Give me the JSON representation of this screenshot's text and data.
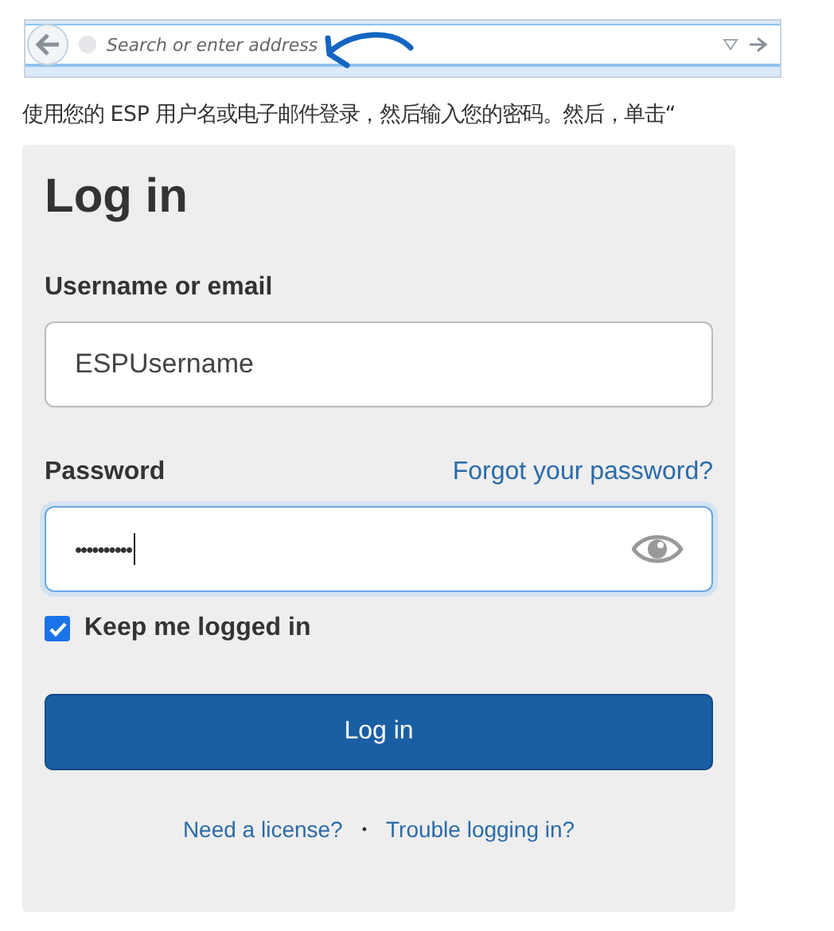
{
  "address_bar": {
    "placeholder": "Search or enter address"
  },
  "instruction": "使用您的 ESP 用户名或电子邮件登录，然后输入您的密码。然后，单击“",
  "login": {
    "title": "Log in",
    "username": {
      "label": "Username or email",
      "value": "ESPUsername"
    },
    "password": {
      "label": "Password",
      "forgot_link": "Forgot your password?",
      "value": "••••••••••",
      "focused": true
    },
    "keep_logged_in": {
      "label": "Keep me logged in",
      "checked": true
    },
    "submit": "Log in",
    "footer_links": [
      "Need a license?",
      "Trouble logging in?"
    ],
    "separator": "•"
  }
}
